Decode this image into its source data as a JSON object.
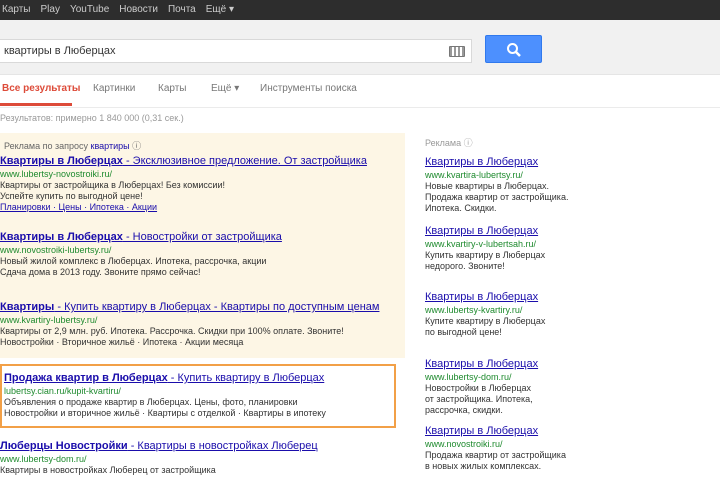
{
  "topbar": {
    "links": [
      "Карты",
      "Play",
      "YouTube",
      "Новости",
      "Почта",
      "Ещё ▾"
    ]
  },
  "search": {
    "query": "квартиры в Люберцах",
    "button_icon": "search-icon"
  },
  "tabs": [
    "Все результаты",
    "Картинки",
    "Карты",
    "Ещё ▾",
    "Инструменты поиска"
  ],
  "stats": "Результатов: примерно 1 840 000 (0,31 сек.)",
  "ads": {
    "header_text": "Реклама по запросу",
    "header_link": "квартиры",
    "items": [
      {
        "title_bold": "Квартиры в Люберцах",
        "title_rest": " - Эксклюзивное предложение. От застройщика",
        "url": "www.lubertsy-novostroiki.ru/",
        "lines": [
          "Квартиры от застройщика в Люберцах! Без комиссии!",
          "Успейте купить по выгодной цене!"
        ],
        "sitelinks": "Планировки · Цены · Ипотека · Акции"
      },
      {
        "title_bold": "Квартиры в Люберцах",
        "title_rest": " - Новостройки от застройщика",
        "url": "www.novostroiki-lubertsy.ru/",
        "lines": [
          "Новый жилой комплекс в Люберцах. Ипотека, рассрочка, акции",
          "Сдача дома в 2013 году. Звоните прямо сейчас!"
        ],
        "sitelinks": ""
      },
      {
        "title_bold": "Квартиры",
        "title_rest": " - Купить квартиру в Люберцах - Квартиры по доступным ценам",
        "url": "www.kvartiry-lubertsy.ru/",
        "lines": [
          "Квартиры от 2,9 млн. руб. Ипотека. Рассрочка. Скидки при 100% оплате. Звоните!",
          "Новостройки · Вторичное жильё · Ипотека · Акции месяца"
        ],
        "sitelinks": ""
      }
    ]
  },
  "organic": [
    {
      "title_bold": "Продажа квартир в Люберцах",
      "title_rest": " - Купить квартиру в Люберцах",
      "url": "lubertsy.cian.ru/kupit-kvartiru/",
      "lines": [
        "Объявления о продаже квартир в Люберцах. Цены, фото, планировки",
        "Новостройки и вторичное жильё · Квартиры с отделкой · Квартиры в ипотеку"
      ]
    },
    {
      "title_bold": "Люберцы Новостройки",
      "title_rest": " - Квартиры в новостройках Люберец",
      "url": "www.lubertsy-dom.ru/",
      "lines": [
        "Квартиры в новостройках Люберец от застройщика"
      ]
    }
  ],
  "right_ads": {
    "header": "Реклама",
    "items": [
      {
        "title": "Квартиры в Люберцах",
        "url": "www.kvartira-lubertsy.ru/",
        "lines": [
          "Новые квартиры в Люберцах.",
          "Продажа квартир от застройщика.",
          "Ипотека. Скидки."
        ]
      },
      {
        "title": "Квартиры в Люберцах",
        "url": "www.kvartiry-v-lubertsah.ru/",
        "lines": [
          "Купить квартиру в Люберцах",
          "недорого. Звоните!"
        ]
      },
      {
        "title": "Квартиры в Люберцах",
        "url": "www.lubertsy-kvartiry.ru/",
        "lines": [
          "Купите квартиру в Люберцах",
          "по выгодной цене!"
        ]
      },
      {
        "title": "Квартиры в Люберцах",
        "url": "www.lubertsy-dom.ru/",
        "lines": [
          "Новостройки в Люберцах",
          "от застройщика. Ипотека,",
          "рассрочка, скидки."
        ]
      },
      {
        "title": "Квартиры в Люберцах",
        "url": "www.novostroiki.ru/",
        "lines": [
          "Продажа квартир от застройщика",
          "в новых жилых комплексах."
        ]
      }
    ]
  }
}
